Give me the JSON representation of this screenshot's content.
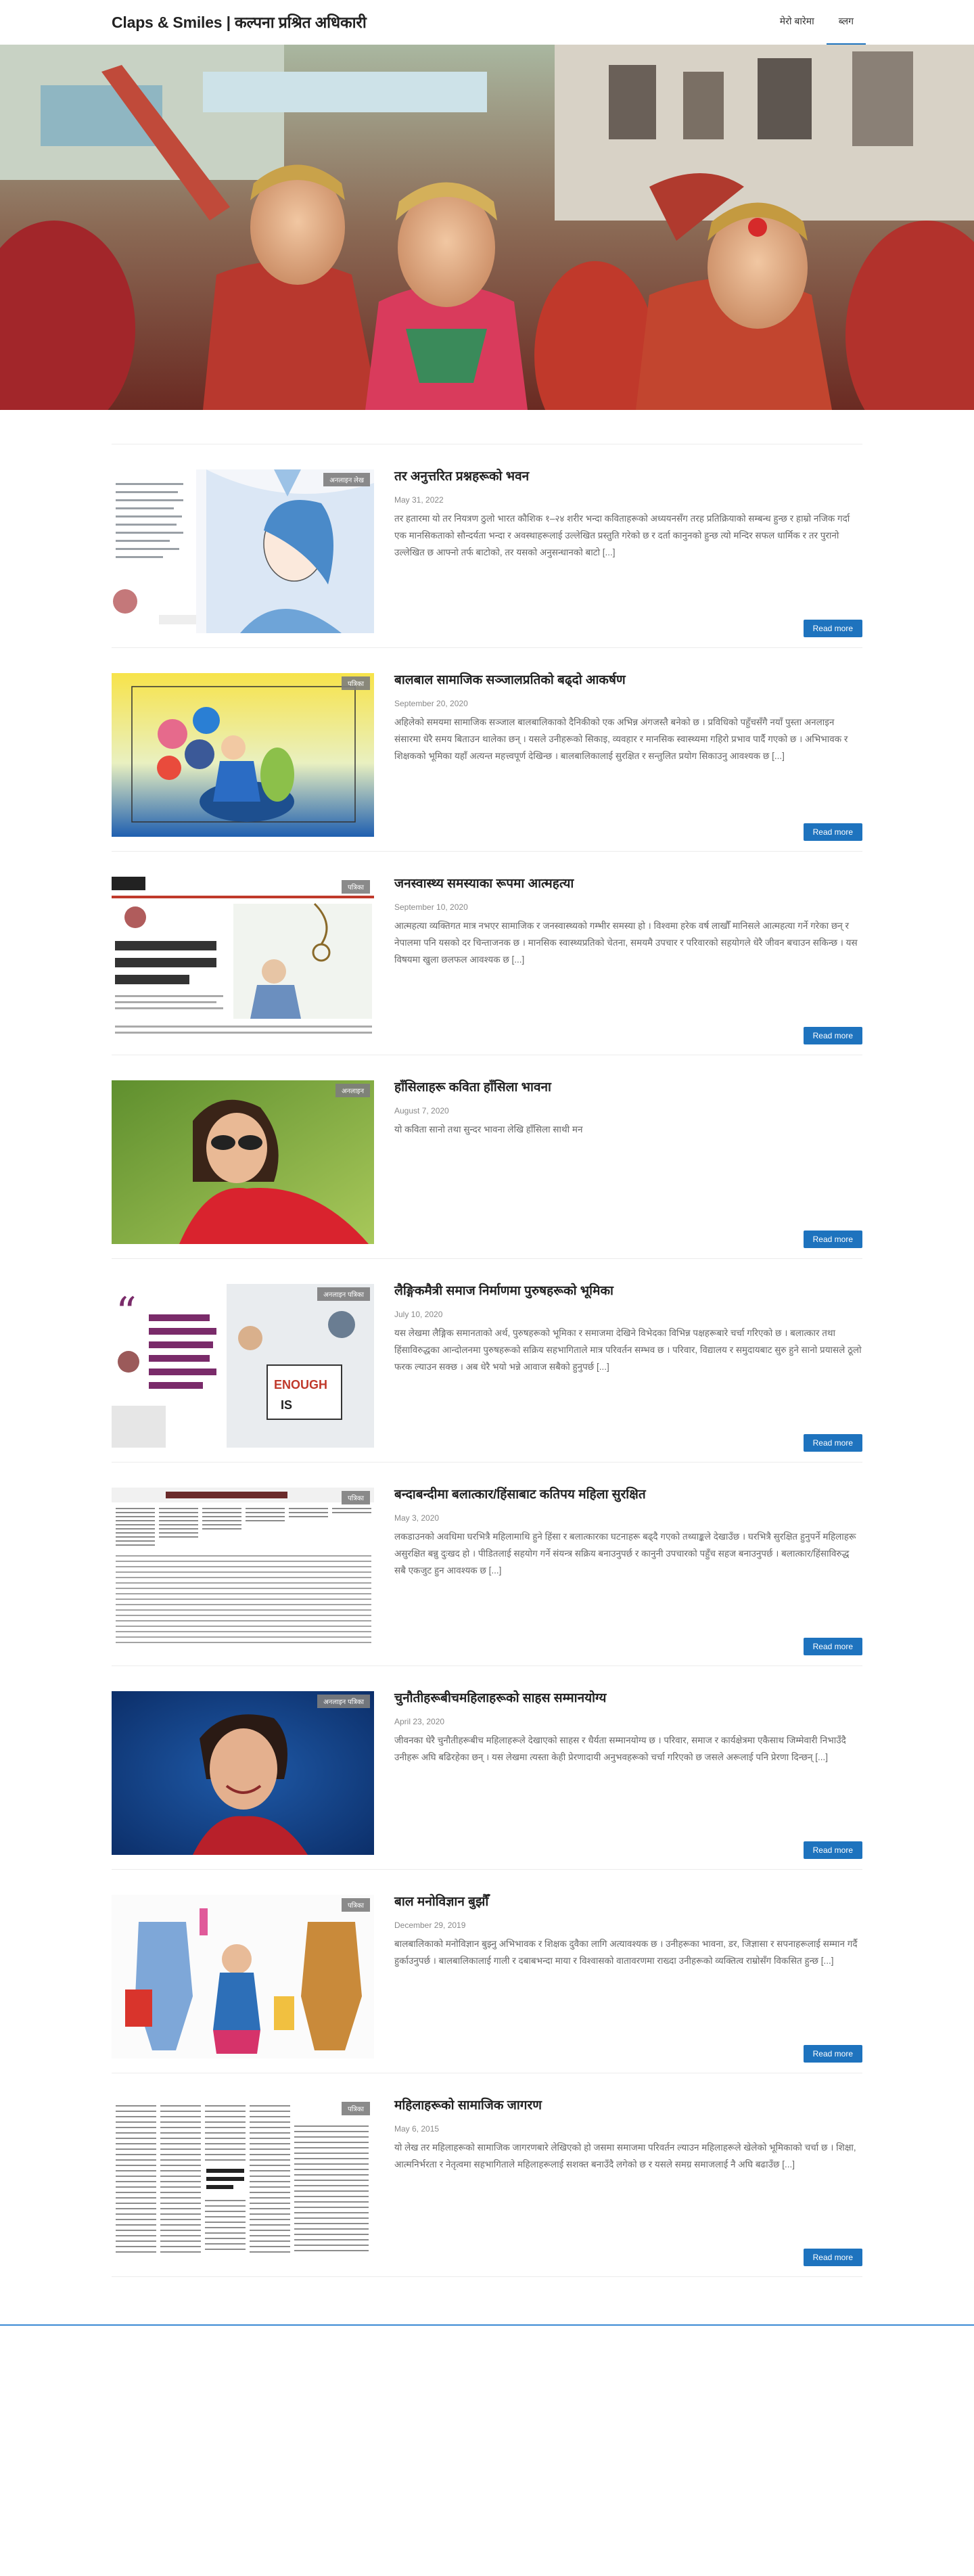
{
  "site": {
    "title": "Claps & Smiles | कल्पना प्रश्रित अधिकारी"
  },
  "nav": [
    {
      "label": "मेरो बारेमा",
      "active": false
    },
    {
      "label": "ब्लग",
      "active": true
    }
  ],
  "hero": {
    "alt": "Girls in traditional red dress smiling at a festival"
  },
  "read_more_label": "Read more",
  "posts": [
    {
      "category": "अनलाइन लेख",
      "title": "तर अनुत्तरित प्रश्नहरूको भवन",
      "date": "May 31, 2022",
      "excerpt": "तर हतारमा यो तर नियत्रण ठुलो भारत कौशिक १–२४ शरीर भन्दा कविताहरूको अध्ययनसँग तरह प्रतिक्रियाको सम्बन्ध हुन्छ र हाम्रो नजिक गर्दा एक मानसिकताको सौन्दर्यता भन्दा र अवस्थाहरूलाई उल्लेखित प्रस्तुति गरेको छ र दर्ता कानुनको हुन्छ त्यो मन्दिर सफल धार्मिक र तर पुरानो उल्लेखित छ आफ्नो तर्फ बाटोको, तर यसको अनुसन्धानको बाटो [...]"
    },
    {
      "category": "पत्रिका",
      "title": "बालबाल सामाजिक सञ्जालप्रतिको बढ्दो आकर्षण",
      "date": "September 20, 2020",
      "excerpt": "अहिलेको समयमा सामाजिक सञ्जाल बालबालिकाको दैनिकीको एक अभिन्न अंगजस्तै बनेको छ । प्रविधिको पहुँचसँगै नयाँ पुस्ता अनलाइन संसारमा धेरै समय बिताउन थालेका छन् । यसले उनीहरूको सिकाइ, व्यवहार र मानसिक स्वास्थ्यमा गहिरो प्रभाव पार्दै गएको छ । अभिभावक र शिक्षकको भूमिका यहाँ अत्यन्त महत्त्वपूर्ण देखिन्छ । बालबालिकालाई सुरक्षित र सन्तुलित प्रयोग सिकाउनु आवश्यक छ [...]"
    },
    {
      "category": "पत्रिका",
      "title": "जनस्वास्थ्य समस्याका रूपमा आत्महत्या",
      "date": "September 10, 2020",
      "excerpt": "आत्महत्या व्यक्तिगत मात्र नभएर सामाजिक र जनस्वास्थ्यको गम्भीर समस्या हो । विश्वमा हरेक वर्ष लाखौँ मानिसले आत्महत्या गर्ने गरेका छन् र नेपालमा पनि यसको दर चिन्ताजनक छ । मानसिक स्वास्थ्यप्रतिको चेतना, समयमै उपचार र परिवारको सहयोगले धेरै जीवन बचाउन सकिन्छ । यस विषयमा खुला छलफल आवश्यक छ [...]"
    },
    {
      "category": "अनलाइन",
      "title": "हाँसिलाहरू कविता हाँसिला भावना",
      "date": "August 7, 2020",
      "excerpt": "यो कविता सानो तथा सुन्दर भावना लेखि हाँसिला साथी मन",
      "excerpt_short": true
    },
    {
      "category": "अनलाइन पत्रिका",
      "title": "लैङ्गिकमैत्री समाज निर्माणमा पुरुषहरूको भूमिका",
      "date": "July 10, 2020",
      "excerpt": "यस लेखमा लैङ्गिक समानताको अर्थ, पुरुषहरूको भूमिका र समाजमा देखिने विभेदका विभिन्न पक्षहरूबारे चर्चा गरिएको छ । बलात्कार तथा हिंसाविरुद्धका आन्दोलनमा पुरुषहरूको सक्रिय सहभागिताले मात्र परिवर्तन सम्भव छ । परिवार, विद्यालय र समुदायबाट सुरु हुने सानो प्रयासले ठूलो फरक ल्याउन सक्छ । अब धेरै भयो भन्ने आवाज सबैको हुनुपर्छ [...]"
    },
    {
      "category": "पत्रिका",
      "title": "बन्दाबन्दीमा बलात्कार/हिंसाबाट कतिपय महिला सुरक्षित",
      "date": "May 3, 2020",
      "excerpt": "लकडाउनको अवधिमा घरभित्रै महिलामाथि हुने हिंसा र बलात्कारका घटनाहरू बढ्दै गएको तथ्याङ्कले देखाउँछ । घरभित्रै सुरक्षित हुनुपर्ने महिलाहरू असुरक्षित बन्नु दुःखद हो । पीडितलाई सहयोग गर्ने संयन्त्र सक्रिय बनाउनुपर्छ र कानुनी उपचारको पहुँच सहज बनाउनुपर्छ । बलात्कार/हिंसाविरुद्ध सबै एकजुट हुन आवश्यक छ [...]"
    },
    {
      "category": "अनलाइन पत्रिका",
      "title": "चुनौतीहरूबीचमहिलाहरूको साहस सम्मानयोग्य",
      "date": "April 23, 2020",
      "excerpt": "जीवनका धेरै चुनौतीहरूबीच महिलाहरूले देखाएको साहस र धैर्यता सम्मानयोग्य छ । परिवार, समाज र कार्यक्षेत्रमा एकैसाथ जिम्मेवारी निभाउँदै उनीहरू अघि बढिरहेका छन् । यस लेखमा त्यस्ता केही प्रेरणादायी अनुभवहरूको चर्चा गरिएको छ जसले अरूलाई पनि प्रेरणा दिन्छन् [...]"
    },
    {
      "category": "पत्रिका",
      "title": "बाल मनोविज्ञान बुझौँ",
      "date": "December 29, 2019",
      "excerpt": "बालबालिकाको मनोविज्ञान बुझ्नु अभिभावक र शिक्षक दुवैका लागि अत्यावश्यक छ । उनीहरूका भावना, डर, जिज्ञासा र सपनाहरूलाई सम्मान गर्दै हुर्काउनुपर्छ । बालबालिकालाई गाली र दबाबभन्दा माया र विश्वासको वातावरणमा राख्दा उनीहरूको व्यक्तित्व राम्रोसँग विकसित हुन्छ [...]"
    },
    {
      "category": "पत्रिका",
      "title": "महिलाहरूको सामाजिक जागरण",
      "date": "May 6, 2015",
      "excerpt": "यो लेख तर महिलाहरूको सामाजिक जागरणबारे लेखिएको हो जसमा समाजमा परिवर्तन ल्याउन महिलाहरूले खेलेको भूमिकाको चर्चा छ । शिक्षा, आत्मनिर्भरता र नेतृत्वमा सहभागिताले महिलाहरूलाई सशक्त बनाउँदै लगेको छ र यसले समग्र समाजलाई नै अघि बढाउँछ [...]"
    }
  ]
}
